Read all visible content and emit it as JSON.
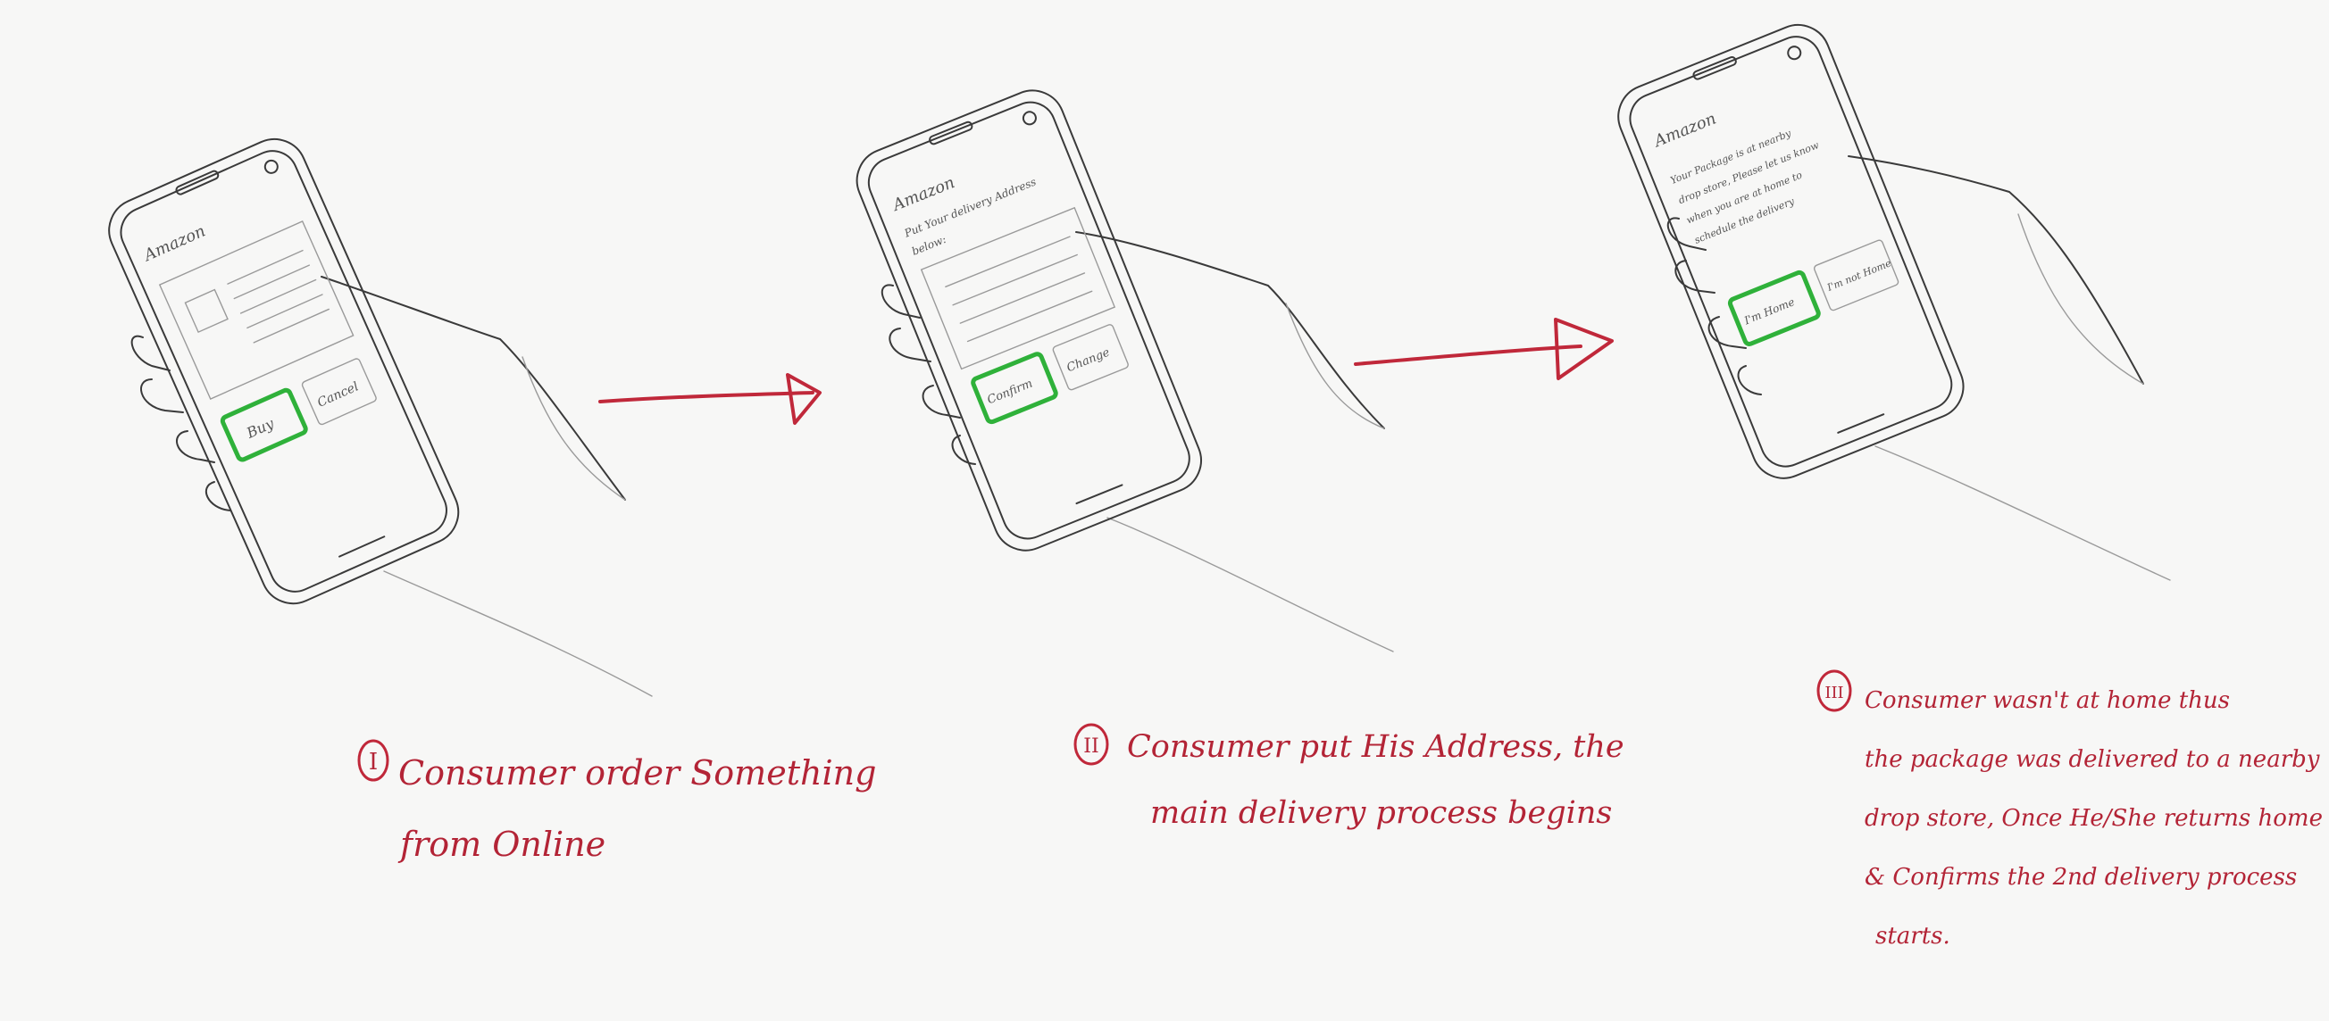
{
  "colors": {
    "pencil": "#3a3a3a",
    "highlight": "#2fb13a",
    "annotation": "#c0283a",
    "paper": "#f7f7f6"
  },
  "steps": [
    {
      "phone": {
        "brand": "Amazon",
        "primary_button": "Buy",
        "secondary_button": "Cancel"
      },
      "caption": {
        "numeral": "I",
        "lines": [
          "Consumer order Something",
          "from Online"
        ]
      }
    },
    {
      "phone": {
        "brand": "Amazon",
        "message_lines": [
          "Put Your delivery Address",
          "below:"
        ],
        "primary_button": "Confirm",
        "secondary_button": "Change"
      },
      "caption": {
        "numeral": "II",
        "lines": [
          "Consumer put His Address, the",
          "main delivery process begins"
        ]
      }
    },
    {
      "phone": {
        "brand": "Amazon",
        "message_lines": [
          "Your Package is at nearby",
          "drop store, Please let us know",
          "when you are at home to",
          "schedule the delivery"
        ],
        "primary_button": "I'm Home",
        "secondary_button": "I'm not Home"
      },
      "caption": {
        "numeral": "III",
        "lines": [
          "Consumer wasn't at home thus",
          "the package was delivered to a nearby",
          "drop store, Once He/She returns home",
          "& Confirms the 2nd delivery process",
          "starts."
        ]
      }
    }
  ]
}
